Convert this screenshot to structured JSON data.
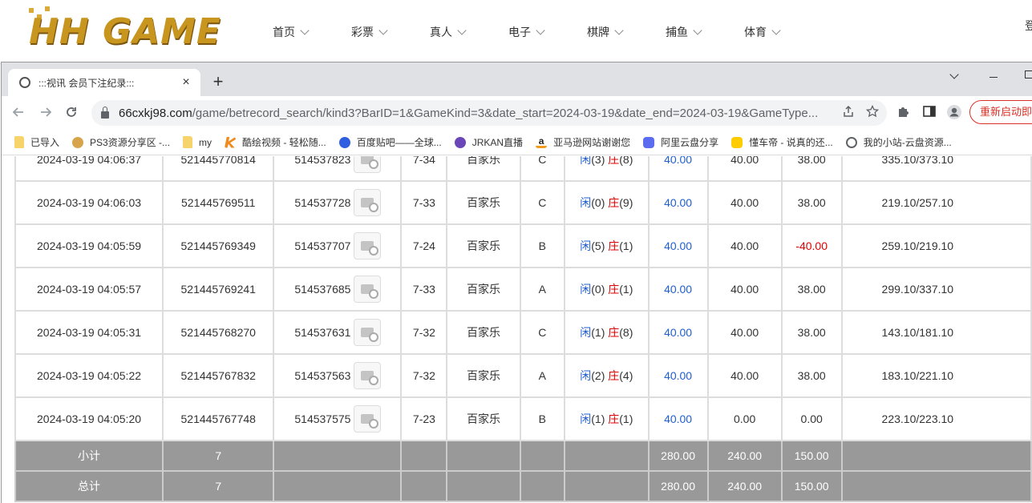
{
  "site": {
    "logo_text": "HH GAME",
    "nav": [
      "首页",
      "彩票",
      "真人",
      "电子",
      "棋牌",
      "捕鱼",
      "体育"
    ],
    "header_right": "登"
  },
  "browser": {
    "tab_title": ":::视讯 会员下注纪录:::",
    "tab_close": "×",
    "new_tab": "+",
    "url_host": "66cxkj98.com",
    "url_path": "/game/betrecord_search/kind3?BarID=1&GameKind=3&date_start=2024-03-19&date_end=2024-03-19&GameType...",
    "relaunch_label": "重新启动即可",
    "bookmarks": [
      {
        "label": "已导入",
        "icon": "folder-icon",
        "color": "#f6d36b"
      },
      {
        "label": "PS3资源分享区 -...",
        "icon": "ps3-icon",
        "color": "#d7a44b"
      },
      {
        "label": "my",
        "icon": "folder-icon",
        "color": "#f6d36b"
      },
      {
        "label": "酷绘视频 - 轻松随...",
        "icon": "k-icon",
        "color": "#f08a1c"
      },
      {
        "label": "百度贴吧——全球...",
        "icon": "baidu-icon",
        "color": "#2f5fe0"
      },
      {
        "label": "JRKAN直播",
        "icon": "jrkan-icon",
        "color": "#6b46b8"
      },
      {
        "label": "亚马逊网站谢谢您",
        "icon": "amazon-icon",
        "color": "#222222"
      },
      {
        "label": "阿里云盘分享",
        "icon": "aliyun-icon",
        "color": "#5b6cf0"
      },
      {
        "label": "懂车帝 - 说真的还...",
        "icon": "dongchedi-icon",
        "color": "#ffcc00"
      },
      {
        "label": "我的小站-云盘资源...",
        "icon": "globe-icon",
        "color": "#5f6368"
      }
    ]
  },
  "records": [
    {
      "time": "2024-03-19 04:06:37",
      "order": "521445770814",
      "wager": "514537823",
      "table": "7-34",
      "game": "百家乐",
      "room": "C",
      "r_player": "闲",
      "r_player_v": "(3)",
      "r_banker": "庄",
      "r_banker_v": "(8)",
      "bet": "40.00",
      "valid": "40.00",
      "win": "38.00",
      "win_neg": false,
      "balance": "335.10/373.10"
    },
    {
      "time": "2024-03-19 04:06:03",
      "order": "521445769511",
      "wager": "514537728",
      "table": "7-33",
      "game": "百家乐",
      "room": "C",
      "r_player": "闲",
      "r_player_v": "(0)",
      "r_banker": "庄",
      "r_banker_v": "(9)",
      "bet": "40.00",
      "valid": "40.00",
      "win": "38.00",
      "win_neg": false,
      "balance": "219.10/257.10"
    },
    {
      "time": "2024-03-19 04:05:59",
      "order": "521445769349",
      "wager": "514537707",
      "table": "7-24",
      "game": "百家乐",
      "room": "B",
      "r_player": "闲",
      "r_player_v": "(5)",
      "r_banker": "庄",
      "r_banker_v": "(1)",
      "bet": "40.00",
      "valid": "40.00",
      "win": "-40.00",
      "win_neg": true,
      "balance": "259.10/219.10"
    },
    {
      "time": "2024-03-19 04:05:57",
      "order": "521445769241",
      "wager": "514537685",
      "table": "7-33",
      "game": "百家乐",
      "room": "A",
      "r_player": "闲",
      "r_player_v": "(0)",
      "r_banker": "庄",
      "r_banker_v": "(1)",
      "bet": "40.00",
      "valid": "40.00",
      "win": "38.00",
      "win_neg": false,
      "balance": "299.10/337.10"
    },
    {
      "time": "2024-03-19 04:05:31",
      "order": "521445768270",
      "wager": "514537631",
      "table": "7-32",
      "game": "百家乐",
      "room": "C",
      "r_player": "闲",
      "r_player_v": "(1)",
      "r_banker": "庄",
      "r_banker_v": "(8)",
      "bet": "40.00",
      "valid": "40.00",
      "win": "38.00",
      "win_neg": false,
      "balance": "143.10/181.10"
    },
    {
      "time": "2024-03-19 04:05:22",
      "order": "521445767832",
      "wager": "514537563",
      "table": "7-32",
      "game": "百家乐",
      "room": "A",
      "r_player": "闲",
      "r_player_v": "(2)",
      "r_banker": "庄",
      "r_banker_v": "(4)",
      "bet": "40.00",
      "valid": "40.00",
      "win": "38.00",
      "win_neg": false,
      "balance": "183.10/221.10"
    },
    {
      "time": "2024-03-19 04:05:20",
      "order": "521445767748",
      "wager": "514537575",
      "table": "7-23",
      "game": "百家乐",
      "room": "B",
      "r_player": "闲",
      "r_player_v": "(1)",
      "r_banker": "庄",
      "r_banker_v": "(1)",
      "bet": "40.00",
      "valid": "0.00",
      "win": "0.00",
      "win_neg": false,
      "balance": "223.10/223.10"
    }
  ],
  "summary": [
    {
      "label": "小计",
      "count": "7",
      "bet": "280.00",
      "valid": "240.00",
      "win": "150.00"
    },
    {
      "label": "总计",
      "count": "7",
      "bet": "280.00",
      "valid": "240.00",
      "win": "150.00"
    }
  ],
  "colors": {
    "player": "#1f5fce",
    "banker": "#e00000",
    "negative": "#e00000",
    "summary_bg": "#999999"
  }
}
